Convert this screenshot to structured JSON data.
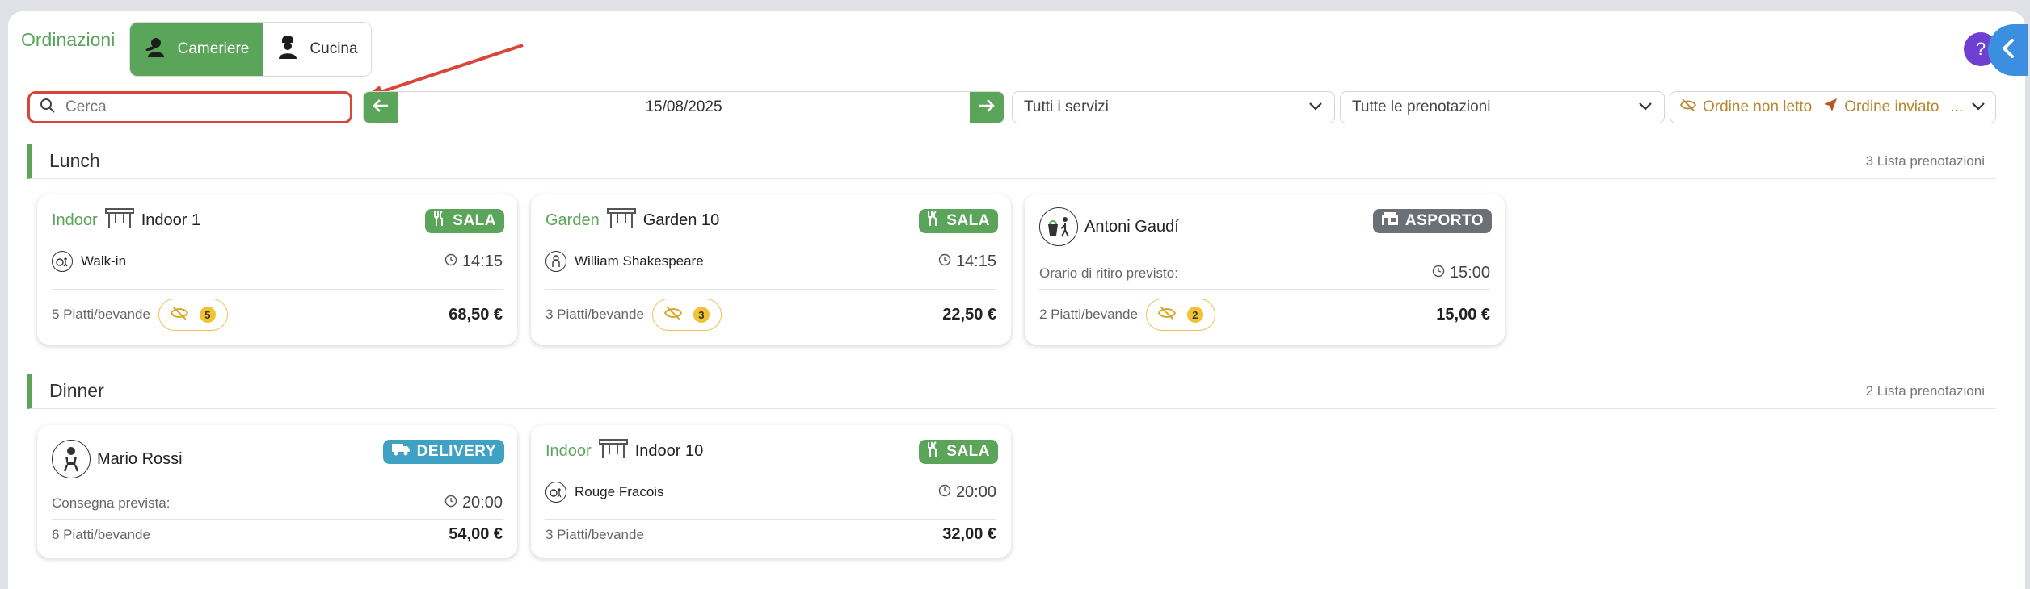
{
  "app_title": "Ordinazioni",
  "modes": [
    {
      "label": "Cameriere",
      "icon": "waiter-icon",
      "active": true
    },
    {
      "label": "Cucina",
      "icon": "chef-icon",
      "active": false
    }
  ],
  "search": {
    "placeholder": "Cerca",
    "value": ""
  },
  "date_nav": {
    "date": "15/08/2025",
    "prev_icon": "arrow-left-icon",
    "next_icon": "arrow-right-icon"
  },
  "filters": {
    "services": "Tutti i servizi",
    "reservations": "Tutte le prenotazioni",
    "status_unread": "Ordine non letto",
    "status_sent": "Ordine inviato",
    "status_more": "..."
  },
  "help_label": "?",
  "colors": {
    "accent": "#5aa55a",
    "highlight": "#d9453b",
    "sala": "#5aa55a",
    "asporto": "#6b6f76",
    "delivery": "#3fa2c4",
    "unread": "#f1c232"
  },
  "sections": [
    {
      "title": "Lunch",
      "count_label": "3 Lista prenotazioni",
      "cards": [
        {
          "zone": "Indoor",
          "table": "Indoor 1",
          "badge": "SALA",
          "customer": "Walk-in",
          "time": "14:15",
          "items": "5 Piatti/bevande",
          "unread": "5",
          "total": "68,50 €"
        },
        {
          "zone": "Garden",
          "table": "Garden 10",
          "badge": "SALA",
          "customer": "William Shakespeare",
          "time": "14:15",
          "items": "3 Piatti/bevande",
          "unread": "3",
          "total": "22,50 €"
        },
        {
          "customer": "Antoni Gaudí",
          "badge": "ASPORTO",
          "time_label": "Orario di ritiro previsto:",
          "time": "15:00",
          "items": "2 Piatti/bevande",
          "unread": "2",
          "total": "15,00 €"
        }
      ]
    },
    {
      "title": "Dinner",
      "count_label": "2 Lista prenotazioni",
      "cards": [
        {
          "customer": "Mario Rossi",
          "badge": "DELIVERY",
          "time_label": "Consegna prevista:",
          "time": "20:00",
          "items": "6 Piatti/bevande",
          "total": "54,00 €"
        },
        {
          "zone": "Indoor",
          "table": "Indoor 10",
          "badge": "SALA",
          "customer": "Rouge Fracois",
          "time": "20:00",
          "items": "3 Piatti/bevande",
          "total": "32,00 €"
        }
      ]
    }
  ]
}
